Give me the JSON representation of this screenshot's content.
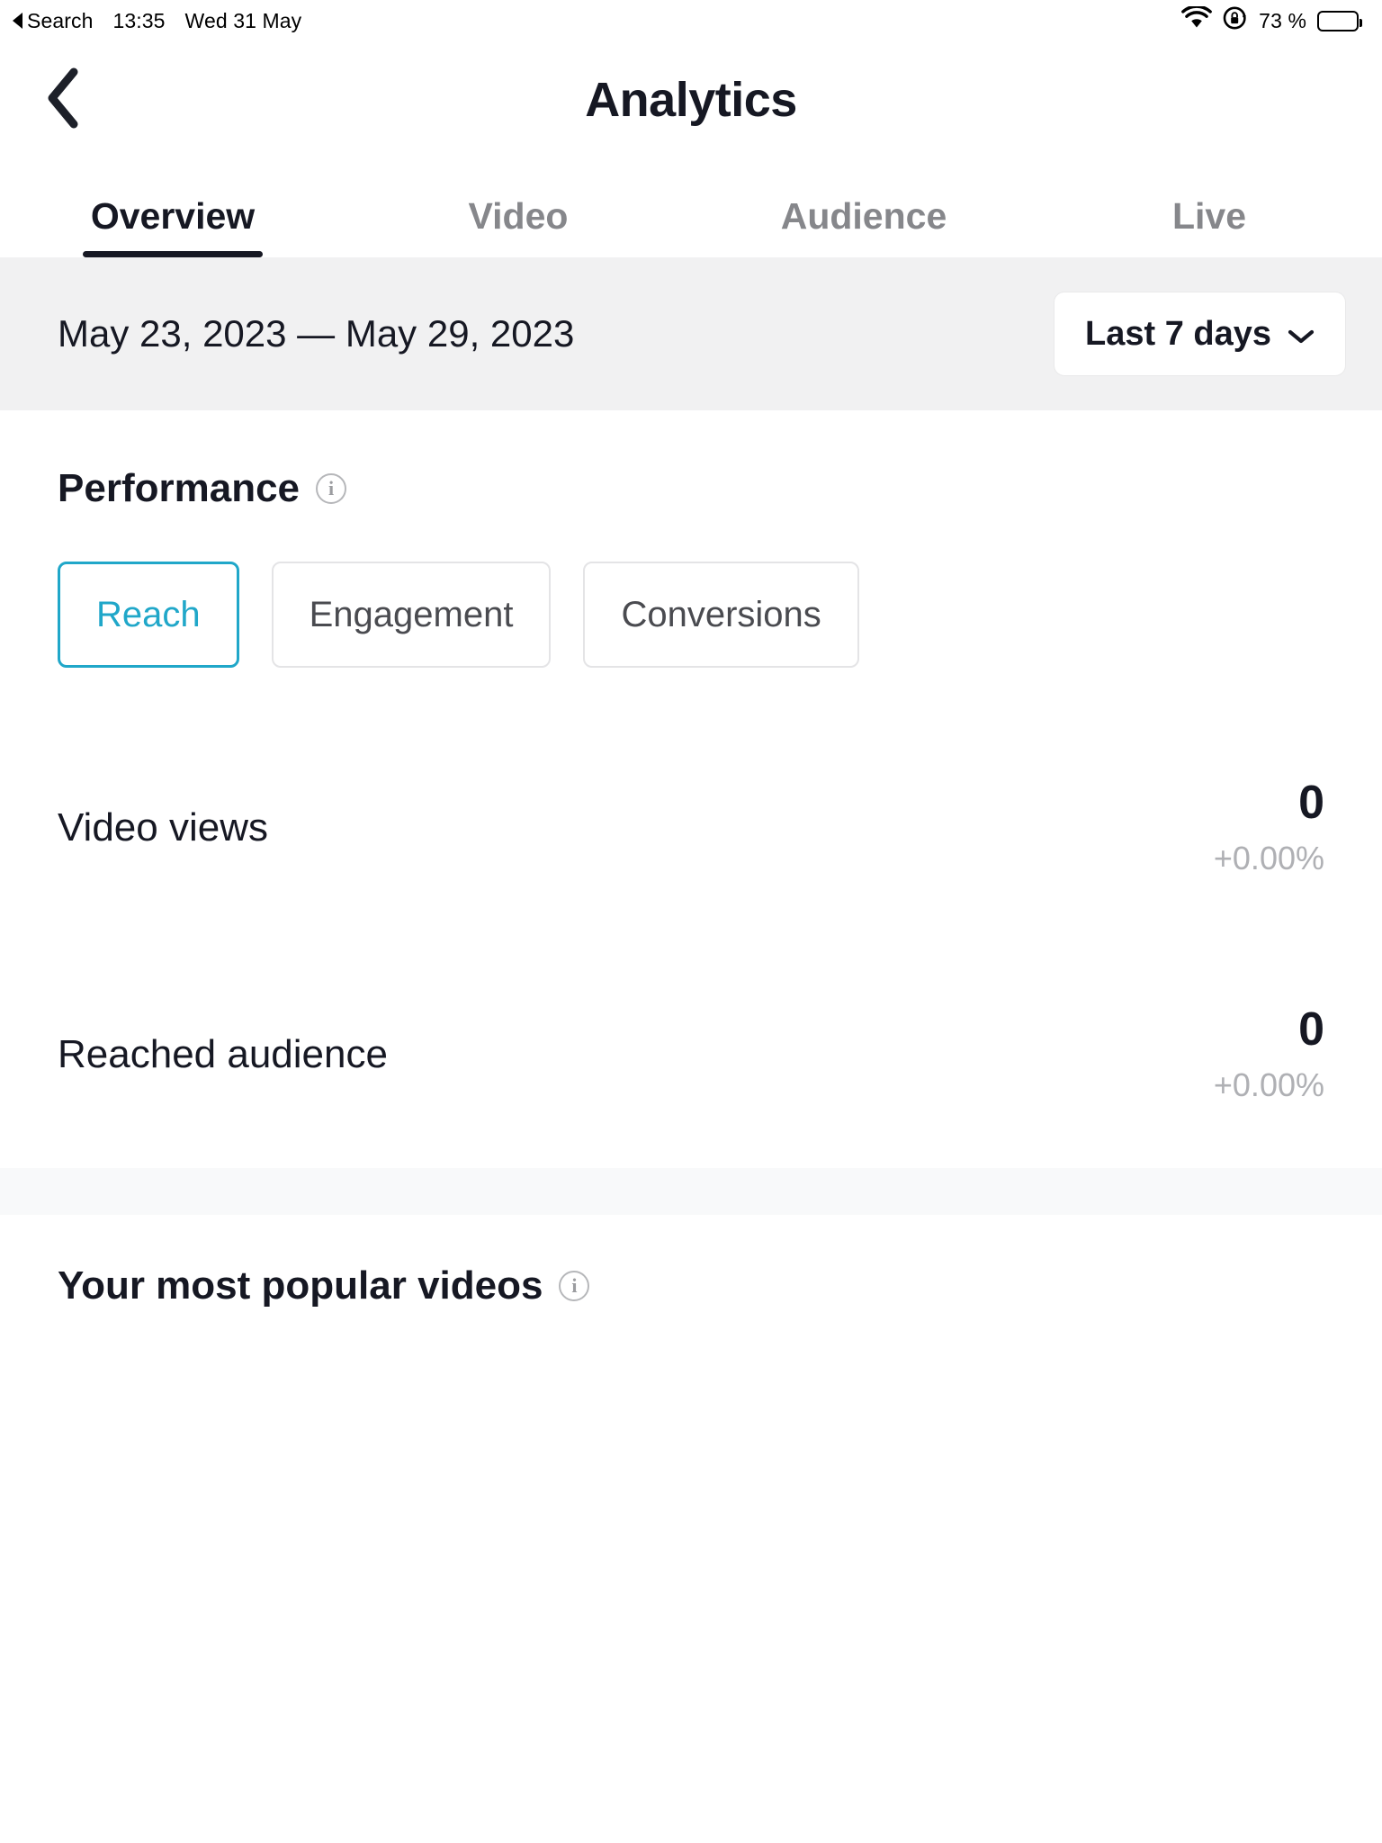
{
  "status_bar": {
    "back_app": "Search",
    "time": "13:35",
    "date": "Wed 31 May",
    "battery_percent": "73 %",
    "wifi_icon": "wifi-icon",
    "rotation_lock_icon": "rotation-lock-icon",
    "battery_icon": "battery-icon",
    "battery_level": 73
  },
  "header": {
    "back_icon": "chevron-left-icon",
    "title": "Analytics"
  },
  "tabs": [
    {
      "label": "Overview",
      "active": true
    },
    {
      "label": "Video",
      "active": false
    },
    {
      "label": "Audience",
      "active": false
    },
    {
      "label": "Live",
      "active": false
    }
  ],
  "date_bar": {
    "range": "May 23, 2023 — May 29, 2023",
    "selector_label": "Last 7 days",
    "selector_icon": "chevron-down-icon"
  },
  "performance": {
    "title": "Performance",
    "info_icon": "info-icon",
    "chips": [
      {
        "label": "Reach",
        "selected": true
      },
      {
        "label": "Engagement",
        "selected": false
      },
      {
        "label": "Conversions",
        "selected": false
      }
    ],
    "metrics": [
      {
        "name": "Video views",
        "value": "0",
        "delta": "+0.00%"
      },
      {
        "name": "Reached audience",
        "value": "0",
        "delta": "+0.00%"
      }
    ]
  },
  "popular_videos": {
    "title": "Your most popular videos",
    "info_icon": "info-icon"
  },
  "colors": {
    "accent": "#20A7C9",
    "text_primary": "#161823",
    "text_muted": "#86878B",
    "text_delta": "#AFB0B4",
    "date_bar_bg": "#F1F1F2",
    "band_bg": "#F8F9FA",
    "border": "#E4E4E6"
  }
}
